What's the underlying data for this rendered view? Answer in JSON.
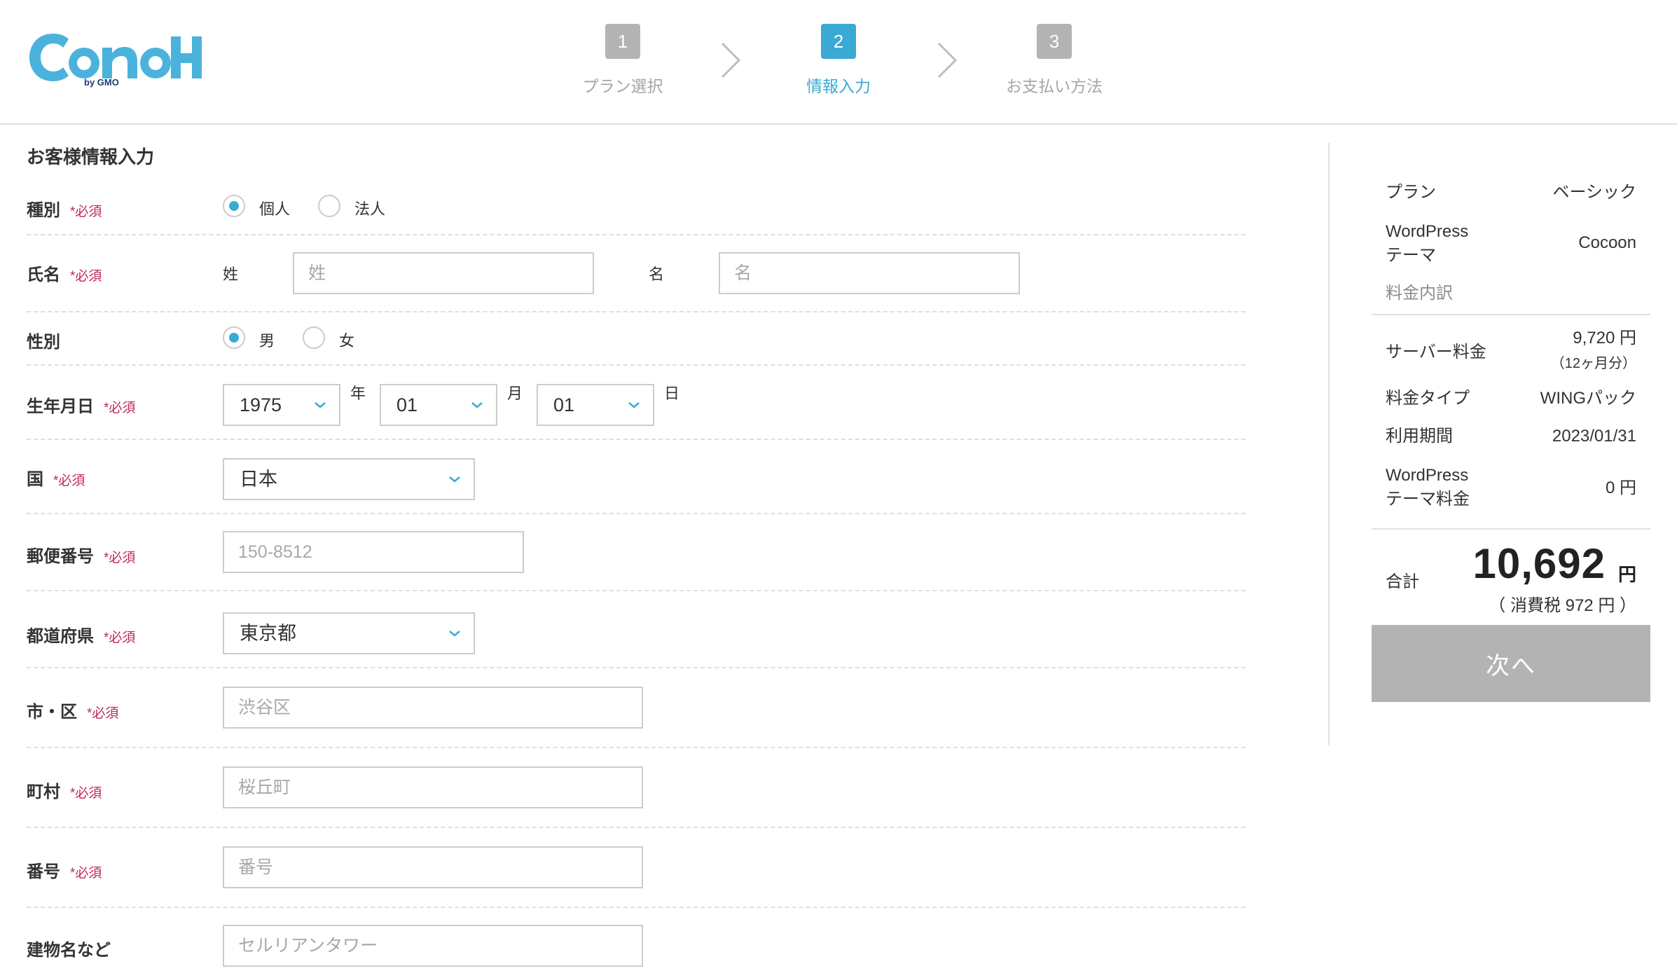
{
  "header": {
    "logo_text": "ConoHa",
    "logo_sub": "by GMO",
    "steps": [
      {
        "num": "1",
        "label": "プラン選択"
      },
      {
        "num": "2",
        "label": "情報入力"
      },
      {
        "num": "3",
        "label": "お支払い方法"
      }
    ],
    "active_step": 2
  },
  "form": {
    "title": "お客様情報入力",
    "required_mark": "*必須",
    "type": {
      "label": "種別",
      "options": [
        "個人",
        "法人"
      ],
      "selected": "個人"
    },
    "name": {
      "label": "氏名",
      "last_label": "姓",
      "last_placeholder": "姓",
      "first_label": "名",
      "first_placeholder": "名"
    },
    "gender": {
      "label": "性別",
      "options": [
        "男",
        "女"
      ],
      "selected": "男"
    },
    "birth": {
      "label": "生年月日",
      "year": "1975",
      "year_unit": "年",
      "month": "01",
      "month_unit": "月",
      "day": "01",
      "day_unit": "日"
    },
    "country": {
      "label": "国",
      "value": "日本"
    },
    "postal": {
      "label": "郵便番号",
      "placeholder": "150-8512"
    },
    "prefecture": {
      "label": "都道府県",
      "value": "東京都"
    },
    "city": {
      "label": "市・区",
      "placeholder": "渋谷区"
    },
    "town": {
      "label": "町村",
      "placeholder": "桜丘町"
    },
    "number": {
      "label": "番号",
      "placeholder": "番号"
    },
    "building": {
      "label": "建物名など",
      "placeholder": "セルリアンタワー"
    }
  },
  "summary": {
    "plan_key": "プラン",
    "plan_val": "ベーシック",
    "theme_key_1": "WordPress",
    "theme_key_2": "テーマ",
    "theme_val": "Cocoon",
    "breakdown": "料金内訳",
    "server_key": "サーバー料金",
    "server_val": "9,720 円",
    "server_sub": "（12ヶ月分）",
    "type_key": "料金タイプ",
    "type_val": "WINGパック",
    "period_key": "利用期間",
    "period_val": "2023/01/31",
    "theme_fee_key_1": "WordPress",
    "theme_fee_key_2": "テーマ料金",
    "theme_fee_val": "0 円",
    "total_key": "合計",
    "total_val": "10,692",
    "total_unit": "円",
    "tax": "（ 消費税 972 円 ）",
    "next_label": "次へ"
  },
  "colors": {
    "accent": "#3aa9d4",
    "required": "#c0285a",
    "inactive": "#b3b3b3"
  }
}
